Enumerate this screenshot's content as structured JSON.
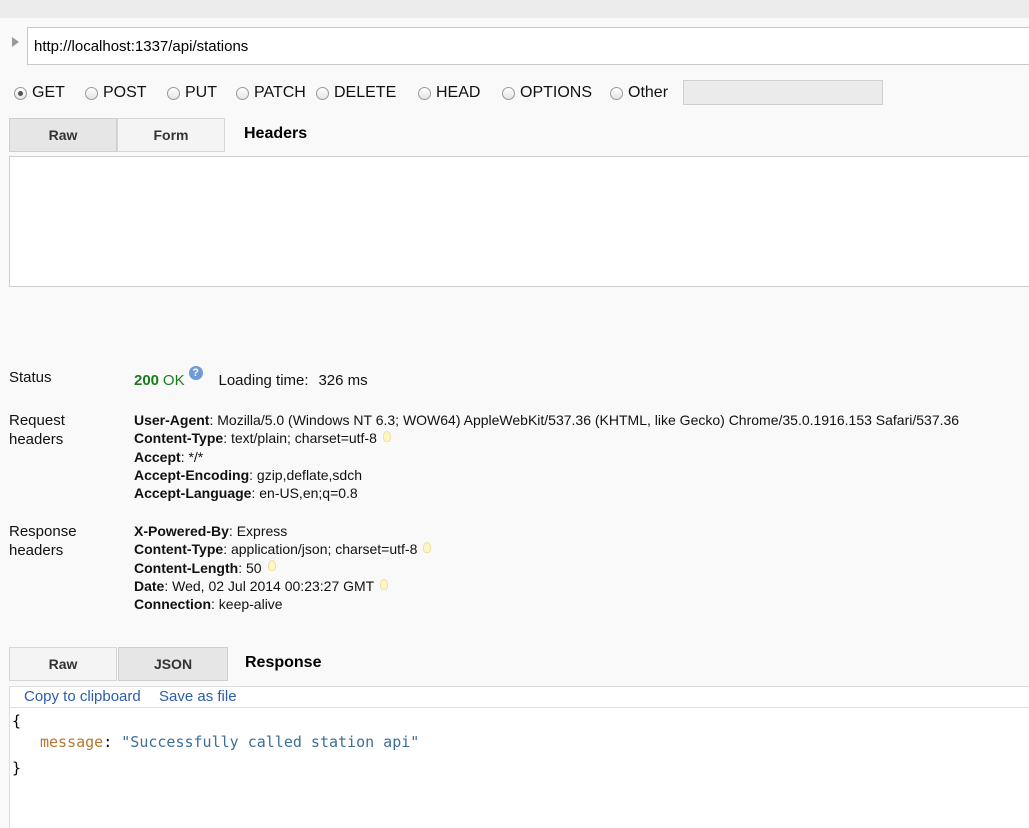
{
  "request": {
    "url": "http://localhost:1337/api/stations",
    "methods": [
      {
        "label": "GET",
        "selected": true
      },
      {
        "label": "POST",
        "selected": false
      },
      {
        "label": "PUT",
        "selected": false
      },
      {
        "label": "PATCH",
        "selected": false
      },
      {
        "label": "DELETE",
        "selected": false
      },
      {
        "label": "HEAD",
        "selected": false
      },
      {
        "label": "OPTIONS",
        "selected": false
      },
      {
        "label": "Other",
        "selected": false
      }
    ],
    "other_method_value": ""
  },
  "headers_tabs": {
    "raw_label": "Raw",
    "form_label": "Form",
    "title": "Headers",
    "selected": "Raw"
  },
  "status": {
    "label": "Status",
    "code": "200",
    "text": "OK",
    "help_glyph": "?",
    "loading_label": "Loading time:",
    "loading_value": "326 ms"
  },
  "request_headers": {
    "label_line1": "Request",
    "label_line2": "headers",
    "items": [
      {
        "name": "User-Agent",
        "value": "Mozilla/5.0 (Windows NT 6.3; WOW64) AppleWebKit/537.36 (KHTML, like Gecko) Chrome/35.0.1916.153 Safari/537.36",
        "hint": false
      },
      {
        "name": "Content-Type",
        "value": "text/plain; charset=utf-8",
        "hint": true
      },
      {
        "name": "Accept",
        "value": "*/*",
        "hint": false
      },
      {
        "name": "Accept-Encoding",
        "value": "gzip,deflate,sdch",
        "hint": false
      },
      {
        "name": "Accept-Language",
        "value": "en-US,en;q=0.8",
        "hint": false
      }
    ]
  },
  "response_headers": {
    "label_line1": "Response",
    "label_line2": "headers",
    "items": [
      {
        "name": "X-Powered-By",
        "value": "Express",
        "hint": false
      },
      {
        "name": "Content-Type",
        "value": "application/json; charset=utf-8",
        "hint": true
      },
      {
        "name": "Content-Length",
        "value": "50",
        "hint": true
      },
      {
        "name": "Date",
        "value": "Wed, 02 Jul 2014 00:23:27 GMT",
        "hint": true
      },
      {
        "name": "Connection",
        "value": "keep-alive",
        "hint": false
      }
    ]
  },
  "response_tabs": {
    "raw_label": "Raw",
    "json_label": "JSON",
    "title": "Response",
    "selected": "JSON"
  },
  "response_actions": {
    "copy_label": "Copy to clipboard",
    "save_label": "Save as file"
  },
  "response_body": {
    "open_brace": "{",
    "key": "message",
    "separator": ": ",
    "value": "\"Successfully called station api\"",
    "close_brace": "}"
  },
  "colors": {
    "status_ok": "#1a7d1a",
    "link": "#2a5db0",
    "json_key": "#b8762e",
    "json_string": "#3d6f99"
  }
}
